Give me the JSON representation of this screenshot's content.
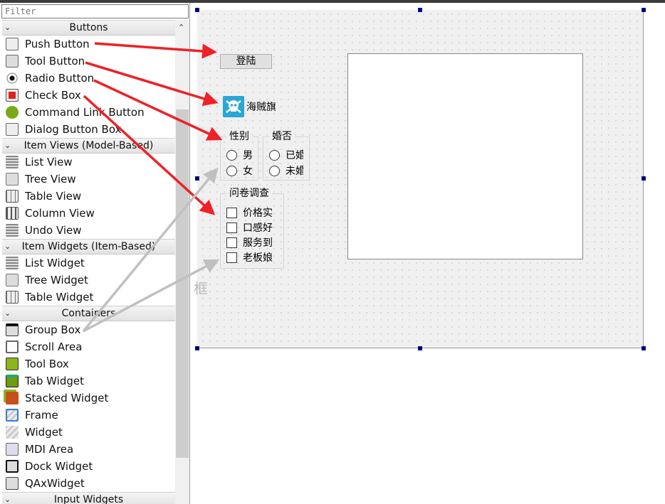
{
  "filter": {
    "placeholder": "Filter"
  },
  "sections": [
    {
      "title": "Buttons",
      "top": 0,
      "items": [
        {
          "label": "Push Button",
          "icon": "push-button-icon"
        },
        {
          "label": "Tool Button",
          "icon": "tool-button-icon"
        },
        {
          "label": "Radio Button",
          "icon": "radio-button-icon"
        },
        {
          "label": "Check Box",
          "icon": "check-box-icon"
        },
        {
          "label": "Command Link Button",
          "icon": "command-link-icon"
        },
        {
          "label": "Dialog Button Box",
          "icon": "dialog-button-box-icon"
        }
      ]
    },
    {
      "title": "Item Views (Model-Based)",
      "items": [
        {
          "label": "List View",
          "icon": "list-view-icon"
        },
        {
          "label": "Tree View",
          "icon": "tree-view-icon"
        },
        {
          "label": "Table View",
          "icon": "table-view-icon"
        },
        {
          "label": "Column View",
          "icon": "column-view-icon"
        },
        {
          "label": "Undo View",
          "icon": "undo-view-icon"
        }
      ]
    },
    {
      "title": "Item Widgets (Item-Based)",
      "items": [
        {
          "label": "List Widget",
          "icon": "list-widget-icon"
        },
        {
          "label": "Tree Widget",
          "icon": "tree-widget-icon"
        },
        {
          "label": "Table Widget",
          "icon": "table-widget-icon"
        }
      ]
    },
    {
      "title": "Containers",
      "items": [
        {
          "label": "Group Box",
          "icon": "group-box-icon"
        },
        {
          "label": "Scroll Area",
          "icon": "scroll-area-icon"
        },
        {
          "label": "Tool Box",
          "icon": "tool-box-icon"
        },
        {
          "label": "Tab Widget",
          "icon": "tab-widget-icon"
        },
        {
          "label": "Stacked Widget",
          "icon": "stacked-widget-icon"
        },
        {
          "label": "Frame",
          "icon": "frame-icon"
        },
        {
          "label": "Widget",
          "icon": "widget-icon"
        },
        {
          "label": "MDI Area",
          "icon": "mdi-area-icon"
        },
        {
          "label": "Dock Widget",
          "icon": "dock-widget-icon"
        },
        {
          "label": "QAxWidget",
          "icon": "qaxwidget-icon"
        }
      ]
    },
    {
      "title": "Input Widgets",
      "items": []
    }
  ],
  "form": {
    "push_button": "登陆",
    "tool_button": "海贼旗",
    "gender": {
      "title": "性别",
      "options": [
        "男",
        "女"
      ]
    },
    "marital": {
      "title": "婚否",
      "options": [
        "已婚",
        "未婚"
      ]
    },
    "survey": {
      "title": "问卷调查",
      "options": [
        "价格实",
        "口感好",
        "服务到",
        "老板娘"
      ]
    },
    "annotation": "框"
  },
  "colors": {
    "arrow_red": "#ee2127",
    "arrow_gray": "#c0c0c0",
    "tool_icon_bg": "#2aa7d5"
  }
}
